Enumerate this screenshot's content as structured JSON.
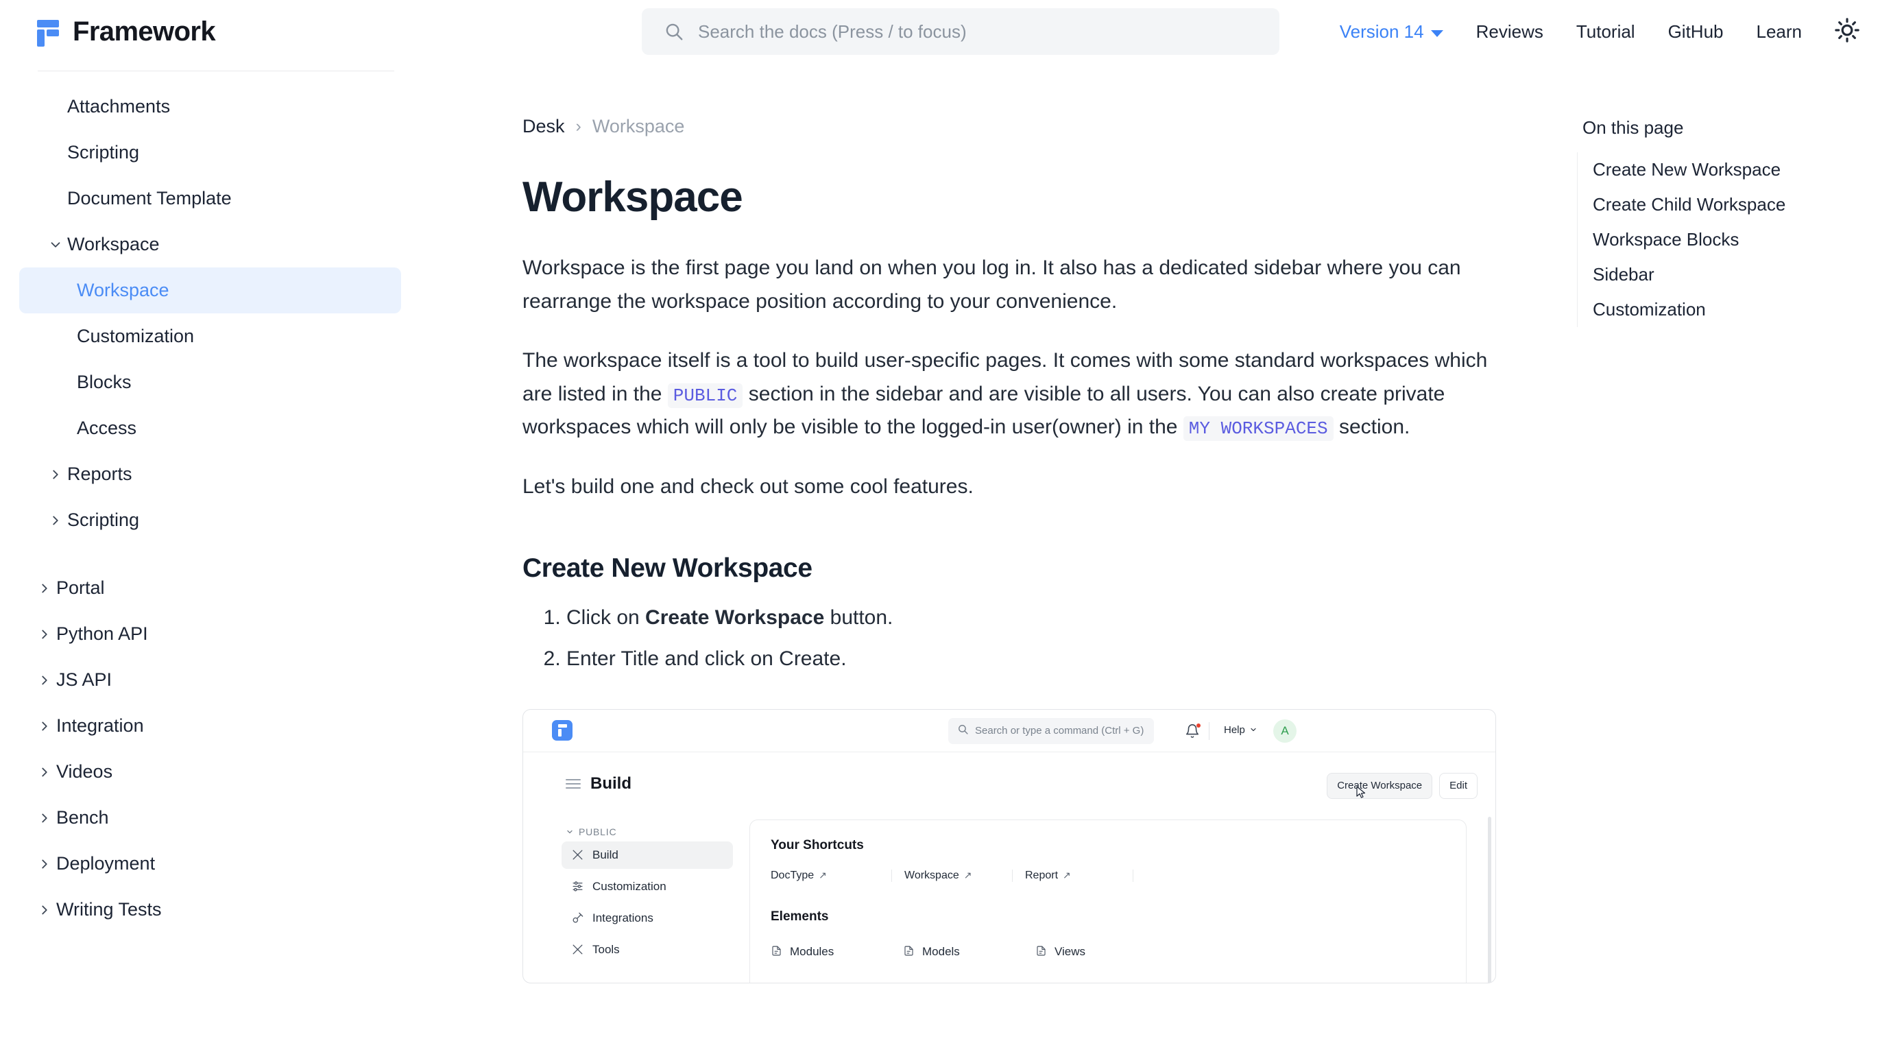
{
  "header": {
    "brand_name": "Framework",
    "logo_icon": "framework-f-logo",
    "search": {
      "placeholder": "Search the docs (Press / to focus)",
      "value": "",
      "icon": "search-icon"
    },
    "nav": [
      {
        "label": "Version 14",
        "type": "dropdown",
        "accent": "#3b82f6"
      },
      {
        "label": "Reviews",
        "type": "link"
      },
      {
        "label": "Tutorial",
        "type": "link"
      },
      {
        "label": "GitHub",
        "type": "link"
      },
      {
        "label": "Learn",
        "type": "link"
      }
    ],
    "theme_toggle_icon": "sun-icon"
  },
  "sidebar": {
    "items": [
      {
        "label": "Attachments",
        "level": 1,
        "chevron": "none",
        "active": false
      },
      {
        "label": "Scripting",
        "level": 1,
        "chevron": "none",
        "active": false
      },
      {
        "label": "Document Template",
        "level": 1,
        "chevron": "none",
        "active": false
      },
      {
        "label": "Workspace",
        "level": 1,
        "chevron": "down",
        "active": false
      },
      {
        "label": "Workspace",
        "level": 2,
        "chevron": "none",
        "active": true
      },
      {
        "label": "Customization",
        "level": 2,
        "chevron": "none",
        "active": false
      },
      {
        "label": "Blocks",
        "level": 2,
        "chevron": "none",
        "active": false
      },
      {
        "label": "Access",
        "level": 2,
        "chevron": "none",
        "active": false
      },
      {
        "label": "Reports",
        "level": 1,
        "chevron": "right",
        "active": false
      },
      {
        "label": "Scripting",
        "level": 1,
        "chevron": "right",
        "active": false
      },
      {
        "label": "Portal",
        "level": 0,
        "chevron": "right",
        "active": false
      },
      {
        "label": "Python API",
        "level": 0,
        "chevron": "right",
        "active": false
      },
      {
        "label": "JS API",
        "level": 0,
        "chevron": "right",
        "active": false
      },
      {
        "label": "Integration",
        "level": 0,
        "chevron": "right",
        "active": false
      },
      {
        "label": "Videos",
        "level": 0,
        "chevron": "right",
        "active": false
      },
      {
        "label": "Bench",
        "level": 0,
        "chevron": "right",
        "active": false
      },
      {
        "label": "Deployment",
        "level": 0,
        "chevron": "right",
        "active": false
      },
      {
        "label": "Writing Tests",
        "level": 0,
        "chevron": "right",
        "active": false
      }
    ]
  },
  "breadcrumb": {
    "parent": "Desk",
    "separator": "›",
    "current": "Workspace"
  },
  "main": {
    "title": "Workspace",
    "paragraph_1": "Workspace is the first page you land on when you log in. It also has a dedicated sidebar where you can rearrange the workspace position according to your convenience.",
    "paragraph_2_a": "The workspace itself is a tool to build user-specific pages. It comes with some standard workspaces which are listed in the ",
    "code_public": "PUBLIC",
    "paragraph_2_b": " section in the sidebar and are visible to all users. You can also create private workspaces which will only be visible to the logged-in user(owner) in the ",
    "code_my_workspaces": "MY WORKSPACES",
    "paragraph_2_c": " section.",
    "paragraph_3": "Let's build one and check out some cool features.",
    "section_heading": "Create New Workspace",
    "steps": [
      {
        "pre": "Click on ",
        "strong": "Create Workspace",
        "post": " button."
      },
      {
        "pre": "Enter Title and click on Create.",
        "strong": "",
        "post": ""
      }
    ]
  },
  "screenshot": {
    "logo_icon": "frappe-logo-icon",
    "search_placeholder": "Search or type a command (Ctrl + G)",
    "search_icon": "search-icon",
    "bell_icon": "bell-icon",
    "help_label": "Help",
    "avatar_initial": "A",
    "menu_icon": "hamburger-icon",
    "page_title": "Build",
    "buttons": [
      {
        "label": "Create Workspace",
        "state": "pressed"
      },
      {
        "label": "Edit",
        "state": "default"
      }
    ],
    "cursor_icon": "cursor-arrow",
    "sidebar_section": "PUBLIC",
    "sidebar_items": [
      {
        "label": "Build",
        "icon": "build-icon",
        "active": true
      },
      {
        "label": "Customization",
        "icon": "sliders-icon",
        "active": false
      },
      {
        "label": "Integrations",
        "icon": "plug-icon",
        "active": false
      },
      {
        "label": "Tools",
        "icon": "tools-icon",
        "active": false
      }
    ],
    "shortcuts_title": "Your Shortcuts",
    "shortcuts": [
      {
        "label": "DocType",
        "icon": "arrow-up-right-icon"
      },
      {
        "label": "Workspace",
        "icon": "arrow-up-right-icon"
      },
      {
        "label": "Report",
        "icon": "arrow-up-right-icon"
      }
    ],
    "elements_title": "Elements",
    "elements": [
      {
        "label": "Modules",
        "icon": "file-icon"
      },
      {
        "label": "Models",
        "icon": "file-icon"
      },
      {
        "label": "Views",
        "icon": "file-icon"
      }
    ]
  },
  "toc": {
    "title": "On this page",
    "items": [
      {
        "label": "Create New Workspace"
      },
      {
        "label": "Create Child Workspace"
      },
      {
        "label": "Workspace Blocks"
      },
      {
        "label": "Sidebar"
      },
      {
        "label": "Customization"
      }
    ]
  },
  "colors": {
    "accent_blue": "#3b82f6",
    "active_pill_bg": "#eaf2fe",
    "active_text": "#4b8cf5",
    "code_purple": "#5b5ce0",
    "text_primary": "#1c2434",
    "text_muted": "#9aa2ad"
  }
}
